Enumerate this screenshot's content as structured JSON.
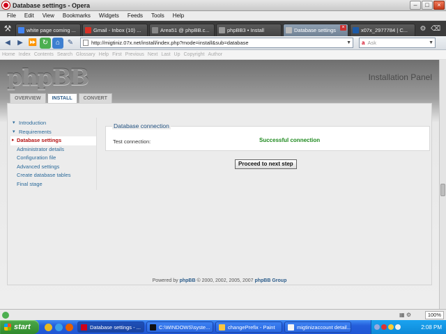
{
  "window": {
    "title": "Database settings - Opera"
  },
  "menu": [
    "File",
    "Edit",
    "View",
    "Bookmarks",
    "Widgets",
    "Feeds",
    "Tools",
    "Help"
  ],
  "tabs": [
    {
      "label": "white page coming ...",
      "favicon_color": "#4285f4"
    },
    {
      "label": "Gmail - Inbox (10) ...",
      "favicon_color": "#d93025"
    },
    {
      "label": "Area51 @ phpBB.c...",
      "favicon_color": "#888888"
    },
    {
      "label": "phpBB3 • Install",
      "favicon_color": "#999999"
    },
    {
      "label": "Database settings",
      "favicon_color": "#999999",
      "active": true
    },
    {
      "label": "x07x_2977784 | C...",
      "favicon_color": "#1c5aa6"
    }
  ],
  "address": {
    "url": "http://migtiniz.07x.net/install/index.php?mode=install&sub=database",
    "search_placeholder": "Ask"
  },
  "link_toolbar": [
    "Home",
    "Index",
    "Contents",
    "Search",
    "Glossary",
    "Help",
    "First",
    "Previous",
    "Next",
    "Last",
    "Up",
    "Copyright",
    "Author"
  ],
  "page": {
    "logo_text": "phpBB",
    "panel_title": "Installation Panel",
    "tabs": [
      {
        "label": "OVERVIEW"
      },
      {
        "label": "INSTALL",
        "active": true
      },
      {
        "label": "CONVERT"
      }
    ],
    "sidebar": [
      {
        "label": "Introduction",
        "kind": "group"
      },
      {
        "label": "Requirements",
        "kind": "group"
      },
      {
        "label": "Database settings",
        "kind": "active"
      },
      {
        "label": "Administrator details"
      },
      {
        "label": "Configuration file"
      },
      {
        "label": "Advanced settings"
      },
      {
        "label": "Create database tables"
      },
      {
        "label": "Final stage"
      }
    ],
    "fieldset": {
      "legend": "Database connection",
      "label": "Test connection:",
      "value": "Successful connection"
    },
    "next_button": "Proceed to next step",
    "footer_prefix": "Powered by ",
    "footer_link": "phpBB",
    "footer_suffix": " © 2000, 2002, 2005, 2007 ",
    "footer_group": "phpBB Group"
  },
  "status": {
    "zoom": "100%"
  },
  "taskbar": {
    "start_label": "start",
    "tasks": [
      {
        "label": "Database settings - ...",
        "active": true,
        "icon_color": "#d0021b"
      },
      {
        "label": "C:\\WINDOWS\\syste...",
        "icon_color": "#111111"
      },
      {
        "label": "changePrefix - Paint",
        "icon_color": "#f5c542"
      },
      {
        "label": "migtinizaccount detail...",
        "icon_color": "#f5f5f5"
      }
    ],
    "clock": "2:08 PM"
  }
}
